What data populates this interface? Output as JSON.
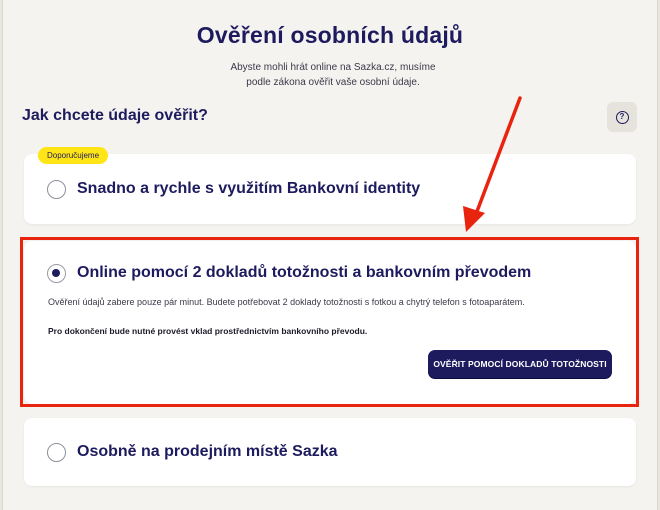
{
  "header": {
    "title": "Ověření osobních údajů",
    "subtitle_line1": "Abyste mohli hrát online na Sazka.cz, musíme",
    "subtitle_line2": "podle zákona ověřit vaše osobní údaje."
  },
  "question": "Jak chcete údaje ověřit?",
  "help": {
    "icon": "question-circle-icon",
    "glyph": "?"
  },
  "options": [
    {
      "badge": "Doporučujeme",
      "label": "Snadno a rychle s využitím Bankovní identity",
      "selected": false
    },
    {
      "label": "Online pomocí 2 dokladů totožnosti a bankovním převodem",
      "selected": true,
      "description": "Ověření údajů zabere pouze pár minut. Budete potřebovat 2 doklady totožnosti s fotkou a chytrý telefon s fotoaparátem.",
      "note": "Pro dokončení bude nutné provést vklad prostřednictvím bankovního převodu.",
      "button_label": "OVĚŘIT POMOCÍ DOKLADŮ TOTOŽNOSTI"
    },
    {
      "label": "Osobně na prodejním místě Sazka",
      "selected": false
    }
  ],
  "colors": {
    "brand_navy": "#1d1b5e",
    "badge_yellow": "#ffe516",
    "annotation_red": "#e8230e",
    "background": "#f5f3ef"
  }
}
